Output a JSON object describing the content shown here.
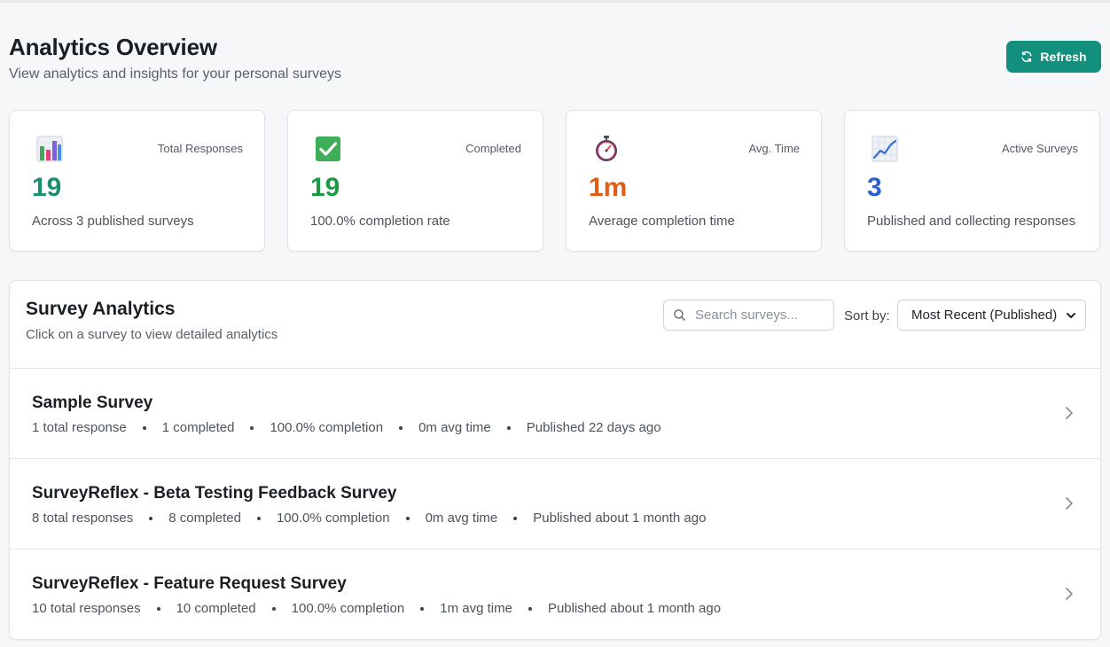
{
  "header": {
    "title": "Analytics Overview",
    "subtitle": "View analytics and insights for your personal surveys",
    "refresh_label": "Refresh"
  },
  "stats": [
    {
      "label": "Total Responses",
      "value": "19",
      "desc": "Across 3 published surveys",
      "color": "#1a8f6e",
      "icon": "bar-chart-icon"
    },
    {
      "label": "Completed",
      "value": "19",
      "desc": "100.0% completion rate",
      "color": "#1b9a47",
      "icon": "check-mark-icon"
    },
    {
      "label": "Avg. Time",
      "value": "1m",
      "desc": "Average completion time",
      "color": "#e05d12",
      "icon": "stopwatch-icon"
    },
    {
      "label": "Active Surveys",
      "value": "3",
      "desc": "Published and collecting responses",
      "color": "#2f5fcf",
      "icon": "trend-chart-icon"
    }
  ],
  "survey_panel": {
    "title": "Survey Analytics",
    "subtitle": "Click on a survey to view detailed analytics",
    "search_placeholder": "Search surveys...",
    "sort_label": "Sort by:",
    "sort_value": "Most Recent (Published)"
  },
  "surveys": [
    {
      "name": "Sample Survey",
      "responses": "1 total response",
      "completed": "1 completed",
      "completion": "100.0% completion",
      "avg_time": "0m avg time",
      "published": "Published 22 days ago"
    },
    {
      "name": "SurveyReflex - Beta Testing Feedback Survey",
      "responses": "8 total responses",
      "completed": "8 completed",
      "completion": "100.0% completion",
      "avg_time": "0m avg time",
      "published": "Published about 1 month ago"
    },
    {
      "name": "SurveyReflex - Feature Request Survey",
      "responses": "10 total responses",
      "completed": "10 completed",
      "completion": "100.0% completion",
      "avg_time": "1m avg time",
      "published": "Published about 1 month ago"
    }
  ],
  "colors": {
    "accent": "#13907d"
  }
}
